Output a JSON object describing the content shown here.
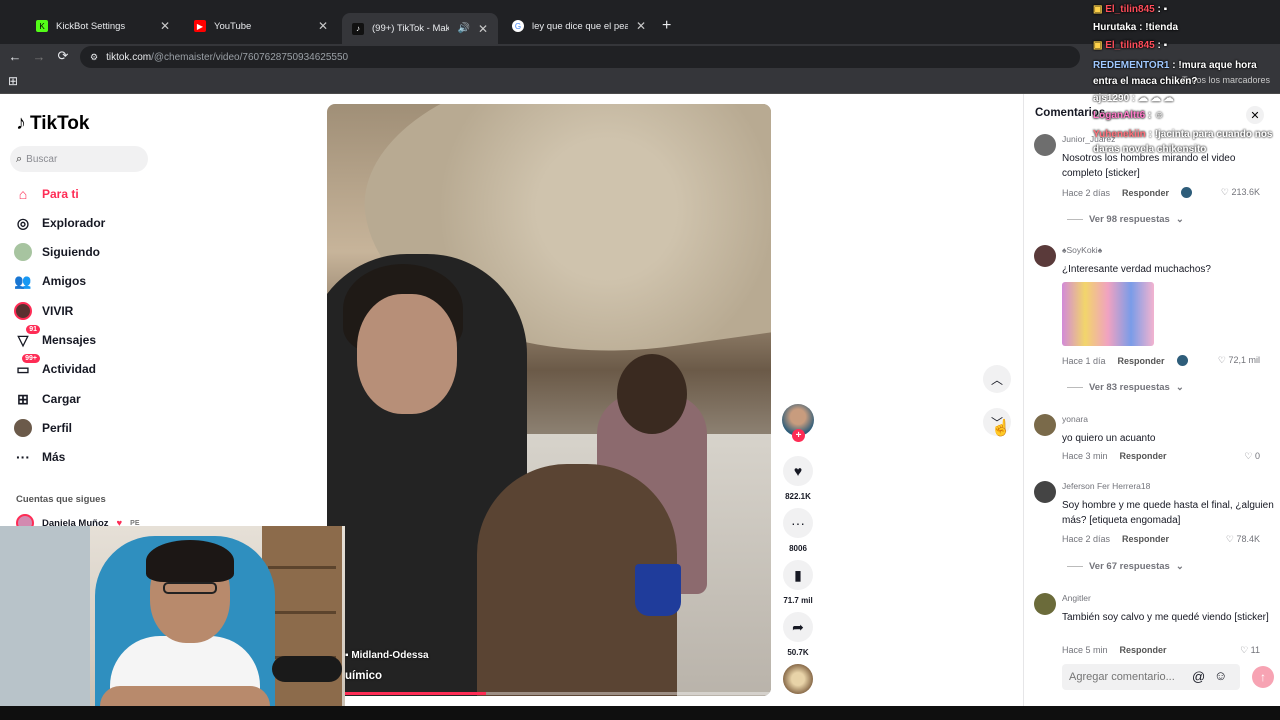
{
  "browser": {
    "tabs": [
      {
        "title": "KickBot Settings",
        "active": false,
        "color": "#53fc18"
      },
      {
        "title": "YouTube",
        "active": false,
        "color": "#ff0000"
      },
      {
        "title": "(99+) TikTok - Make Your D...",
        "active": true,
        "color": "#111111"
      },
      {
        "title": "ley que dice que el peaton tien...",
        "active": false,
        "color": "#4285f4"
      }
    ],
    "url_host": "tiktok.com",
    "url_path": "/@chemaister/video/7607628750934625550",
    "bookmarks_all": "Todos los marcadores"
  },
  "tiktok": {
    "logo": "TikTok",
    "search_placeholder": "Buscar",
    "nav": [
      {
        "label": "Para ti",
        "icon": "home-icon"
      },
      {
        "label": "Explorador",
        "icon": "compass-icon"
      },
      {
        "label": "Siguiendo",
        "icon": "following-avatar-icon"
      },
      {
        "label": "Amigos",
        "icon": "friends-icon"
      },
      {
        "label": "VIVIR",
        "icon": "live-avatar-icon"
      },
      {
        "label": "Mensajes",
        "icon": "message-icon",
        "badge": "91"
      },
      {
        "label": "Actividad",
        "icon": "activity-icon",
        "badge": "99+"
      },
      {
        "label": "Cargar",
        "icon": "upload-icon"
      },
      {
        "label": "Perfil",
        "icon": "profile-avatar-icon"
      },
      {
        "label": "Más",
        "icon": "more-icon"
      }
    ],
    "following_heading": "Cuentas que sigues",
    "following_user": "Daniela Muñoz",
    "following_flag": "PE",
    "video": {
      "location": "Midland-Odessa",
      "title": "uímico",
      "progress": 0.33,
      "likes": "822.1K",
      "comments": "8006",
      "saves": "71.7 mil",
      "shares": "50.7K"
    },
    "comments_panel": {
      "title": "Comentarios",
      "input_placeholder": "Agregar comentario...",
      "reply_label": "Responder",
      "items": [
        {
          "user": "Junior_Juarez",
          "text": "Nosotros los hombres mirando el video completo [sticker]",
          "time": "Hace 2 días",
          "likes": "213.6K",
          "more": "Ver 98 respuestas"
        },
        {
          "user": "♠SoyKoki♠",
          "text": "¿Interesante verdad muchachos?",
          "time": "Hace 1 día",
          "likes": "72,1 mil",
          "more": "Ver 83 respuestas"
        },
        {
          "user": "yonara",
          "text": "yo quiero un acuanto",
          "time": "Hace 3 min",
          "likes": "0",
          "more": ""
        },
        {
          "user": "Jeferson Fer Herrera18",
          "text": "Soy hombre y me quede hasta el final, ¿alguien más? [etiqueta engomada]",
          "time": "Hace 2 días",
          "likes": "78.4K",
          "more": "Ver 67 respuestas"
        },
        {
          "user": "Angitler",
          "text": "También soy calvo y me quedé viendo [sticker]",
          "time": "Hace 5 min",
          "likes": "11",
          "more": ""
        }
      ]
    }
  },
  "chat": [
    {
      "user": "El_tilin845",
      "msg": "",
      "color": "#ff4d5a"
    },
    {
      "user": "Hurutaka",
      "msg": "!tienda",
      "color": "#ffffff"
    },
    {
      "user": "El_tilin845",
      "msg": "",
      "color": "#ff4d5a"
    },
    {
      "user": "REDEMENTOR1",
      "msg": "!mura aque hora entra el maca chiken?",
      "color": "#9fc8ff"
    },
    {
      "user": "ajs1290",
      "msg": "",
      "color": "#ffffff"
    },
    {
      "user": "LoganAltt6",
      "msg": "",
      "color": "#ff7ac9"
    },
    {
      "user": "Yuhenekiin",
      "msg": "!jacinta para cuando nos daras novela chikensito",
      "color": "#ff4d5a"
    }
  ]
}
